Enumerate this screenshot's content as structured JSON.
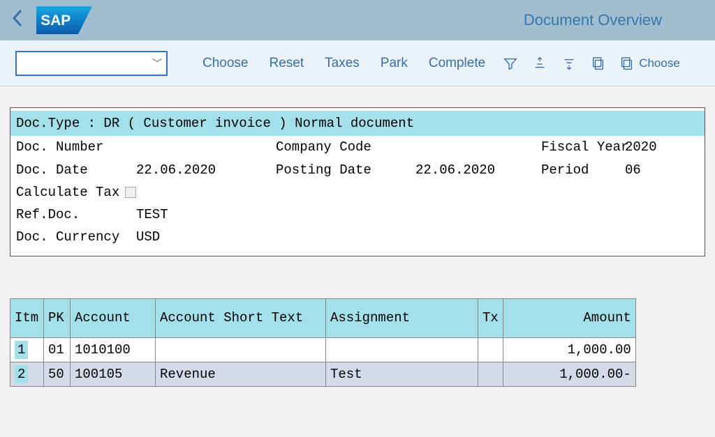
{
  "header": {
    "title": "Document Overview"
  },
  "toolbar": {
    "choose": "Choose",
    "reset": "Reset",
    "taxes": "Taxes",
    "park": "Park",
    "complete": "Complete",
    "choose2": "Choose"
  },
  "doc": {
    "type_line": "Doc.Type : DR ( Customer invoice ) Normal document",
    "labels": {
      "doc_number": "Doc. Number",
      "company_code": "Company Code",
      "fiscal_year": "Fiscal Year",
      "doc_date": "Doc. Date",
      "posting_date": "Posting Date",
      "period": "Period",
      "calc_tax": "Calculate Tax",
      "ref_doc": "Ref.Doc.",
      "doc_currency": "Doc. Currency"
    },
    "values": {
      "doc_number": "",
      "company_code": "",
      "fiscal_year": "2020",
      "doc_date": "22.06.2020",
      "posting_date": "22.06.2020",
      "period": "06",
      "ref_doc": "TEST",
      "doc_currency": "USD"
    }
  },
  "items": {
    "headers": {
      "itm": "Itm",
      "pk": "PK",
      "account": "Account",
      "account_short": "Account Short Text",
      "assignment": "Assignment",
      "tx": "Tx",
      "amount": "Amount"
    },
    "rows": [
      {
        "itm": "1",
        "pk": "01",
        "account": "1010100",
        "short": "",
        "assignment": "",
        "tx": "",
        "amount": "1,000.00"
      },
      {
        "itm": "2",
        "pk": "50",
        "account": "100105",
        "short": "Revenue",
        "assignment": "Test",
        "tx": "",
        "amount": "1,000.00-"
      }
    ]
  }
}
